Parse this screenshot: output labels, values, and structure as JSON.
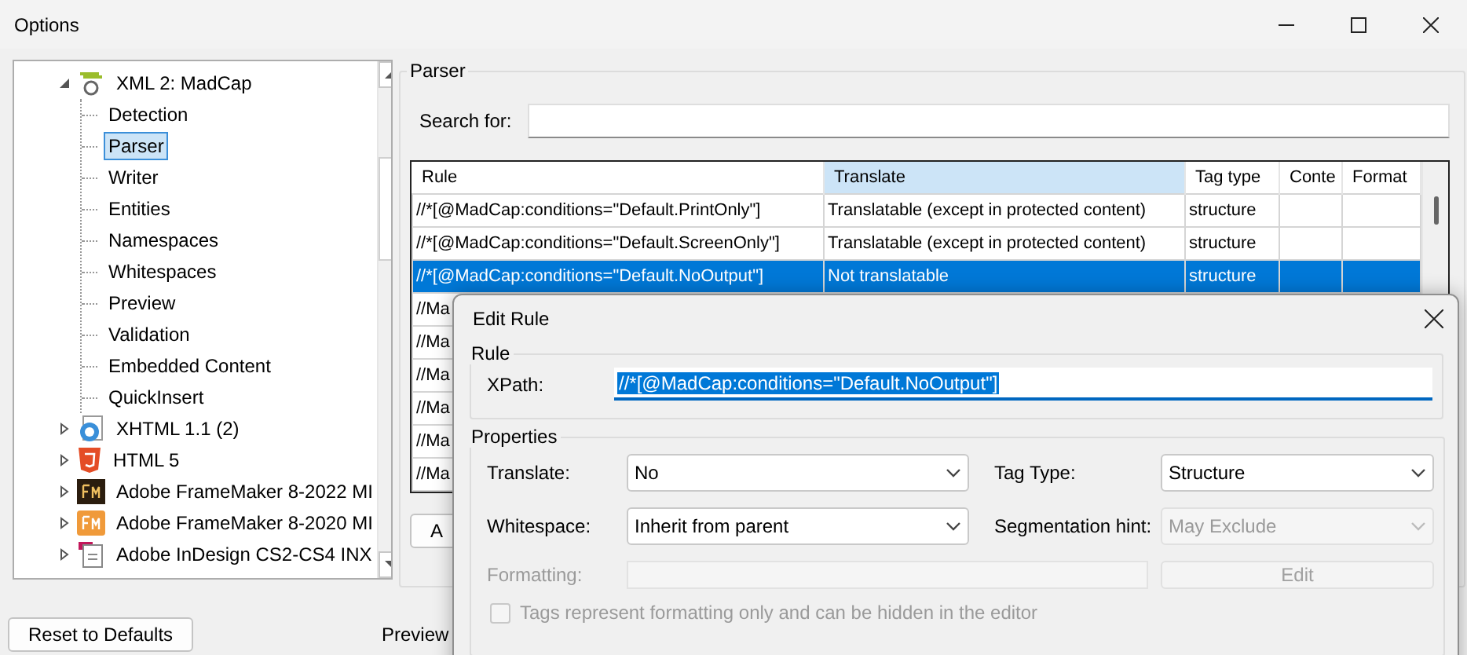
{
  "window": {
    "title": "Options"
  },
  "tree": {
    "items": [
      {
        "label": "XML 2: MadCap",
        "kind": "madcap",
        "expanded": true,
        "selected": false,
        "children": [
          {
            "label": "Detection",
            "selected": false
          },
          {
            "label": "Parser",
            "selected": true
          },
          {
            "label": "Writer",
            "selected": false
          },
          {
            "label": "Entities",
            "selected": false
          },
          {
            "label": "Namespaces",
            "selected": false
          },
          {
            "label": "Whitespaces",
            "selected": false
          },
          {
            "label": "Preview",
            "selected": false
          },
          {
            "label": "Validation",
            "selected": false
          },
          {
            "label": "Embedded Content",
            "selected": false
          },
          {
            "label": "QuickInsert",
            "selected": false
          }
        ]
      },
      {
        "label": "XHTML 1.1 (2)",
        "kind": "xhtml",
        "expanded": false,
        "selected": false
      },
      {
        "label": "HTML 5",
        "kind": "html5",
        "expanded": false,
        "selected": false
      },
      {
        "label": "Adobe FrameMaker 8-2022 MI",
        "kind": "fmdark",
        "expanded": false,
        "selected": false
      },
      {
        "label": "Adobe FrameMaker 8-2020 MI",
        "kind": "fmorange",
        "expanded": false,
        "selected": false
      },
      {
        "label": "Adobe InDesign CS2-CS4 INX",
        "kind": "document",
        "expanded": false,
        "selected": false
      }
    ]
  },
  "reset_button": "Reset to Defaults",
  "preview_label": "Preview",
  "parser": {
    "legend": "Parser",
    "search": {
      "label": "Search for:"
    },
    "table": {
      "columns": [
        {
          "label": "Rule",
          "sorted": false
        },
        {
          "label": "Translate",
          "sorted": true
        },
        {
          "label": "Tag type",
          "sorted": false
        },
        {
          "label": "Conte",
          "sorted": false
        },
        {
          "label": "Format",
          "sorted": false
        }
      ],
      "rows": [
        {
          "selected": false,
          "cells": [
            "//*[@MadCap:conditions=\"Default.PrintOnly\"]",
            "Translatable (except in protected content)",
            "structure",
            "",
            ""
          ]
        },
        {
          "selected": false,
          "cells": [
            "//*[@MadCap:conditions=\"Default.ScreenOnly\"]",
            "Translatable (except in protected content)",
            "structure",
            "",
            ""
          ]
        },
        {
          "selected": true,
          "cells": [
            "//*[@MadCap:conditions=\"Default.NoOutput\"]",
            "Not translatable",
            "structure",
            "",
            ""
          ]
        },
        {
          "selected": false,
          "cells": [
            "//Ma"
          ]
        },
        {
          "selected": false,
          "cells": [
            "//Ma"
          ]
        },
        {
          "selected": false,
          "cells": [
            "//Ma"
          ]
        },
        {
          "selected": false,
          "cells": [
            "//Ma"
          ]
        },
        {
          "selected": false,
          "cells": [
            "//Ma"
          ]
        },
        {
          "selected": false,
          "cells": [
            "//Ma"
          ]
        }
      ]
    },
    "button": "A"
  },
  "dialog": {
    "title": "Edit Rule",
    "rule": {
      "legend": "Rule",
      "label": "XPath:",
      "value": "//*[@MadCap:conditions=\"Default.NoOutput\"]",
      "focused": true
    },
    "properties": {
      "legend": "Properties",
      "fields": [
        {
          "label": "Translate:",
          "value": "No",
          "disabled": false
        },
        {
          "label": "Tag Type:",
          "value": "Structure",
          "disabled": false
        },
        {
          "label": "Whitespace:",
          "value": "Inherit from parent",
          "disabled": false
        },
        {
          "label": "Segmentation hint:",
          "value": "May Exclude",
          "disabled": true
        }
      ],
      "formatting": {
        "label": "Formatting:",
        "button": "Edit",
        "disabled": true
      },
      "checkbox": {
        "label": "Tags represent formatting only and can be hidden in the editor",
        "checked": false,
        "disabled": true
      }
    }
  }
}
